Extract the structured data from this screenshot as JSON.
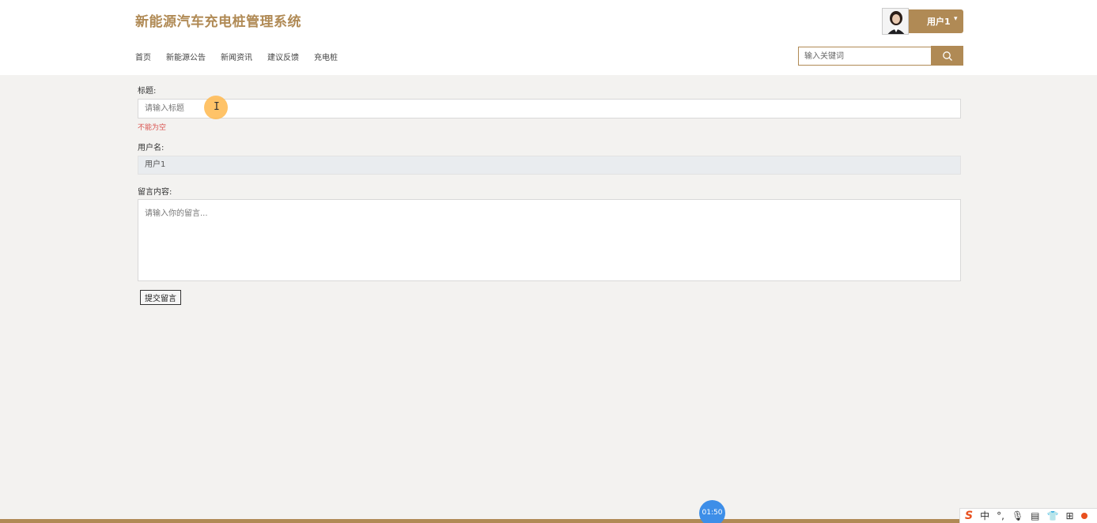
{
  "header": {
    "site_title": "新能源汽车充电桩管理系统",
    "user_name": "用户1",
    "user_caret": "▾",
    "nav": [
      "首页",
      "新能源公告",
      "新闻资讯",
      "建议反馈",
      "充电桩"
    ],
    "search": {
      "placeholder": "输入关键词",
      "icon": "search-icon"
    }
  },
  "form": {
    "title_label": "标题:",
    "title_placeholder": "请输入标题",
    "title_error": "不能为空",
    "username_label": "用户名:",
    "username_value": "用户1",
    "content_label": "留言内容:",
    "content_placeholder": "请输入你的留言...",
    "submit_label": "提交留言"
  },
  "overlay": {
    "timer": "01:50"
  },
  "tray": {
    "items": [
      "S",
      "中",
      "°,",
      "🎙",
      "▤",
      "👕",
      "⊞"
    ]
  },
  "colors": {
    "brand": "#b08a55",
    "error": "#d9534f",
    "timer": "#3d8ee8"
  }
}
